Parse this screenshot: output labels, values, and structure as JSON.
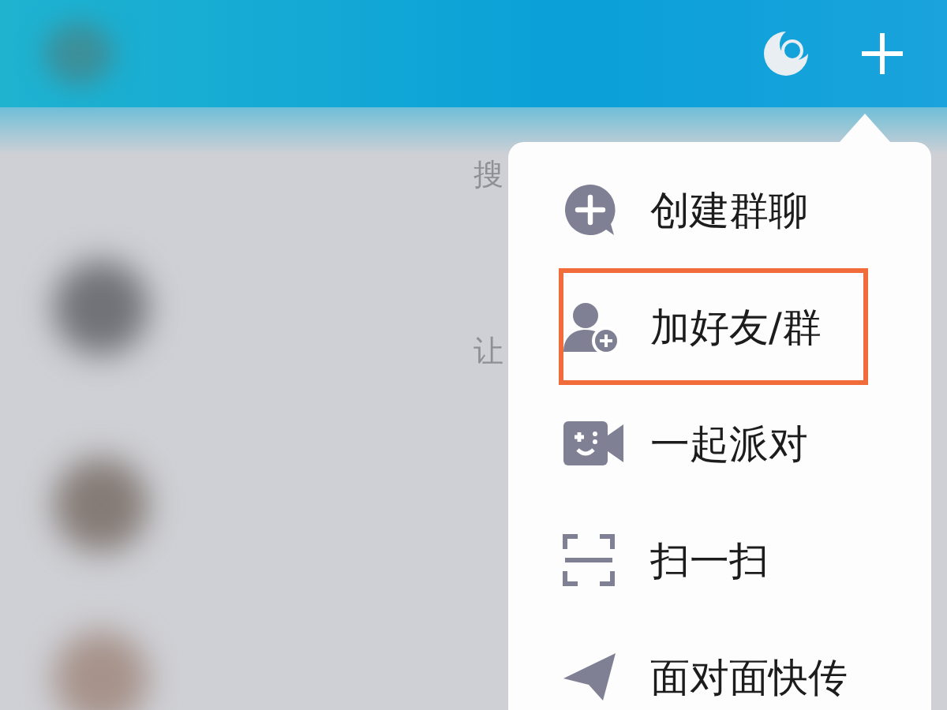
{
  "background": {
    "texts": [
      "搜",
      "让"
    ]
  },
  "menu": {
    "items": [
      {
        "kind": "chat-plus",
        "label": "创建群聊",
        "highlighted": false
      },
      {
        "kind": "person-plus",
        "label": "加好友/群",
        "highlighted": true
      },
      {
        "kind": "video",
        "label": "一起派对",
        "highlighted": false
      },
      {
        "kind": "scan",
        "label": "扫一扫",
        "highlighted": false
      },
      {
        "kind": "send",
        "label": "面对面快传",
        "highlighted": false
      }
    ]
  }
}
